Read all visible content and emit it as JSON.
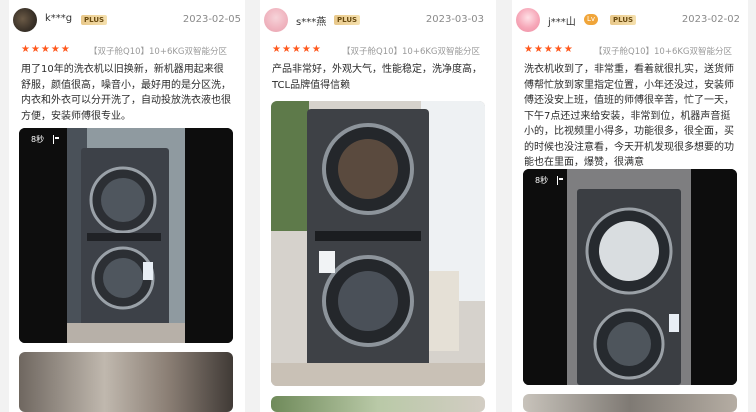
{
  "reviews": [
    {
      "user": "k***g",
      "badge": "PLUS",
      "date": "2023-02-05",
      "stars": "★★★★★",
      "spec": "【双子舱Q10】10+6KG双智能分区",
      "text": "用了10年的洗衣机以旧换新，新机器用起来很舒服，颜值很高，噪音小，最好用的是分区洗，内衣和外衣可以分开洗了，自动投放洗衣液也很方便，安装师傅很专业。",
      "video_time": "8秒"
    },
    {
      "user": "s***燕",
      "badge": "PLUS",
      "date": "2023-03-03",
      "stars": "★★★★★",
      "spec": "【双子舱Q10】10+6KG双智能分区",
      "text": "产品非常好，外观大气，性能稳定，洗净度高，TCL品牌值得信赖"
    },
    {
      "user": "j***山",
      "badge_level": "Lv",
      "badge": "PLUS",
      "date": "2023-02-02",
      "stars": "★★★★★",
      "spec": "【双子舱Q10】10+6KG双智能分区",
      "text": "洗衣机收到了，非常重，看着就很扎实，送货师傅帮忙放到家里指定位置，小年还没过，安装师傅还没安上班，值班的师傅很辛苦，忙了一天，下午7点还过来给安装，非常到位，机器声音挺小的，比视频里小得多，功能很多，很全面，买的时候也没注意看，今天开机发现很多想要的功能也在里面，爆赞，很满意",
      "video_time": "8秒"
    }
  ],
  "colors": {
    "star": "#ff5a1f",
    "badge": "#e8c88a",
    "text": "#2b2b2b",
    "muted": "#8a8a8a"
  }
}
